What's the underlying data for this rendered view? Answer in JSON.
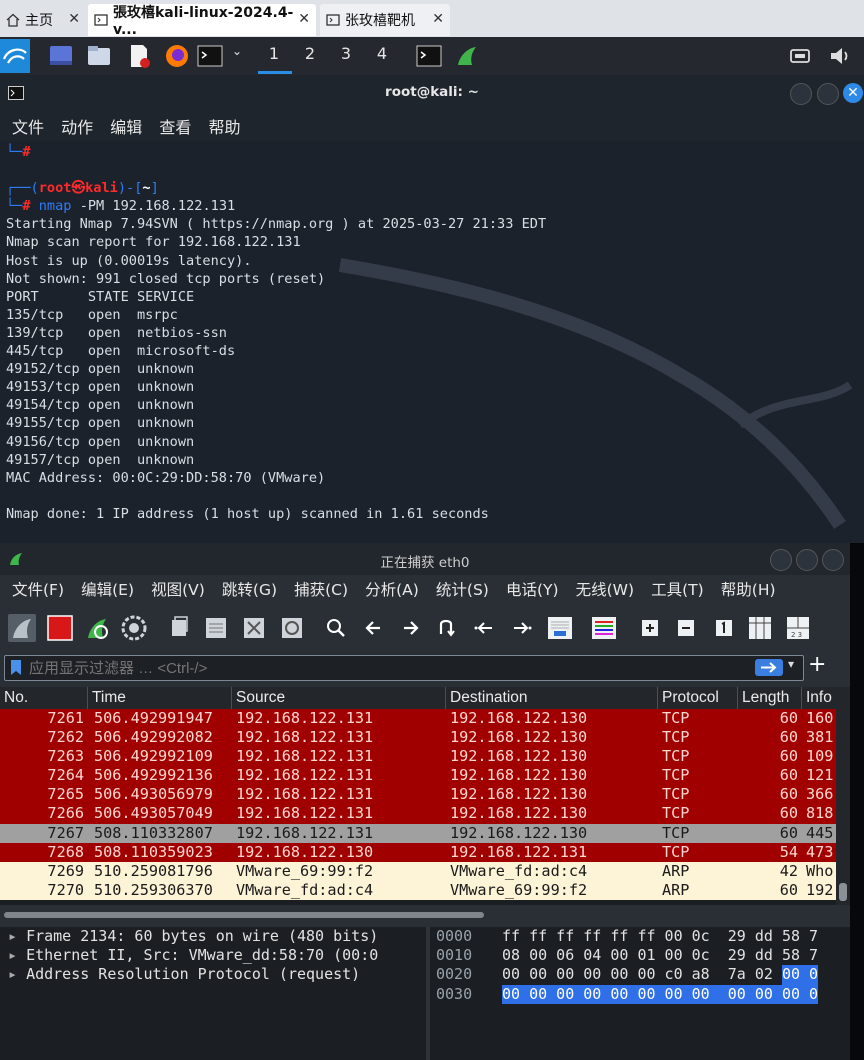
{
  "browser": {
    "tabs": [
      {
        "label": "主页"
      },
      {
        "label": "張玫橲kali-linux-2024.4-v..."
      },
      {
        "label": "张玫橲靶机"
      }
    ]
  },
  "panel": {
    "workspaces": [
      "1",
      "2",
      "3",
      "4"
    ],
    "icons": [
      "kali-menu-icon",
      "desktop-icon",
      "files-icon",
      "text-editor-icon",
      "firefox-icon",
      "terminal-icon",
      "wireshark-icon",
      "network-icon",
      "volume-icon"
    ]
  },
  "terminal": {
    "title": "root@kali: ~",
    "menu": [
      "文件",
      "动作",
      "编辑",
      "查看",
      "帮助"
    ],
    "prompt": {
      "user": "root",
      "host": "kali",
      "dir": "~",
      "command": "nmap",
      "args": "-PM 192.168.122.131"
    },
    "output": [
      "Starting Nmap 7.94SVN ( https://nmap.org ) at 2025-03-27 21:33 EDT",
      "Nmap scan report for 192.168.122.131",
      "Host is up (0.00019s latency).",
      "Not shown: 991 closed tcp ports (reset)",
      "PORT      STATE SERVICE",
      "135/tcp   open  msrpc",
      "139/tcp   open  netbios-ssn",
      "445/tcp   open  microsoft-ds",
      "49152/tcp open  unknown",
      "49153/tcp open  unknown",
      "49154/tcp open  unknown",
      "49155/tcp open  unknown",
      "49156/tcp open  unknown",
      "49157/tcp open  unknown",
      "MAC Address: 00:0C:29:DD:58:70 (VMware)",
      "",
      "Nmap done: 1 IP address (1 host up) scanned in 1.61 seconds"
    ]
  },
  "wireshark": {
    "title": "正在捕获 eth0",
    "menu": [
      "文件(F)",
      "编辑(E)",
      "视图(V)",
      "跳转(G)",
      "捕获(C)",
      "分析(A)",
      "统计(S)",
      "电话(Y)",
      "无线(W)",
      "工具(T)",
      "帮助(H)"
    ],
    "filter_placeholder": "应用显示过滤器 … <Ctrl-/>",
    "columns": [
      "No.",
      "Time",
      "Source",
      "Destination",
      "Protocol",
      "Length",
      "Info"
    ],
    "packets": [
      {
        "no": "7261",
        "time": "506.492991947",
        "src": "192.168.122.131",
        "dst": "192.168.122.130",
        "proto": "TCP",
        "len": "60",
        "info": "160",
        "style": "red"
      },
      {
        "no": "7262",
        "time": "506.492992082",
        "src": "192.168.122.131",
        "dst": "192.168.122.130",
        "proto": "TCP",
        "len": "60",
        "info": "381",
        "style": "red"
      },
      {
        "no": "7263",
        "time": "506.492992109",
        "src": "192.168.122.131",
        "dst": "192.168.122.130",
        "proto": "TCP",
        "len": "60",
        "info": "109",
        "style": "red"
      },
      {
        "no": "7264",
        "time": "506.492992136",
        "src": "192.168.122.131",
        "dst": "192.168.122.130",
        "proto": "TCP",
        "len": "60",
        "info": "121",
        "style": "red"
      },
      {
        "no": "7265",
        "time": "506.493056979",
        "src": "192.168.122.131",
        "dst": "192.168.122.130",
        "proto": "TCP",
        "len": "60",
        "info": "366",
        "style": "red"
      },
      {
        "no": "7266",
        "time": "506.493057049",
        "src": "192.168.122.131",
        "dst": "192.168.122.130",
        "proto": "TCP",
        "len": "60",
        "info": "818",
        "style": "red"
      },
      {
        "no": "7267",
        "time": "508.110332807",
        "src": "192.168.122.131",
        "dst": "192.168.122.130",
        "proto": "TCP",
        "len": "60",
        "info": "445",
        "style": "gray"
      },
      {
        "no": "7268",
        "time": "508.110359023",
        "src": "192.168.122.130",
        "dst": "192.168.122.131",
        "proto": "TCP",
        "len": "54",
        "info": "473",
        "style": "red"
      },
      {
        "no": "7269",
        "time": "510.259081796",
        "src": "VMware_69:99:f2",
        "dst": "VMware_fd:ad:c4",
        "proto": "ARP",
        "len": "42",
        "info": "Who",
        "style": "cream"
      },
      {
        "no": "7270",
        "time": "510.259306370",
        "src": "VMware_fd:ad:c4",
        "dst": "VMware_69:99:f2",
        "proto": "ARP",
        "len": "60",
        "info": "192",
        "style": "cream"
      }
    ],
    "detail": [
      "Frame 2134: 60 bytes on wire (480 bits)",
      "Ethernet II, Src: VMware_dd:58:70 (00:0",
      "Address Resolution Protocol (request)"
    ],
    "bytes": [
      {
        "offset": "0000",
        "hex": "ff ff ff ff ff ff 00 0c  29 dd 58 7",
        "hl": ""
      },
      {
        "offset": "0010",
        "hex": "08 00 06 04 00 01 00 0c  29 dd 58 7",
        "hl": ""
      },
      {
        "offset": "0020",
        "hex": "00 00 00 00 00 00 c0 a8  7a 02 ",
        "hl": "00 0"
      },
      {
        "offset": "0030",
        "hex": "",
        "hl": "00 00 00 00 00 00 00 00  00 00 00 0"
      }
    ],
    "colors": {
      "red": "#a10000",
      "gray": "#a0a0a0",
      "cream": "#fdf3d7",
      "red_text": "#ffd8d2"
    }
  }
}
